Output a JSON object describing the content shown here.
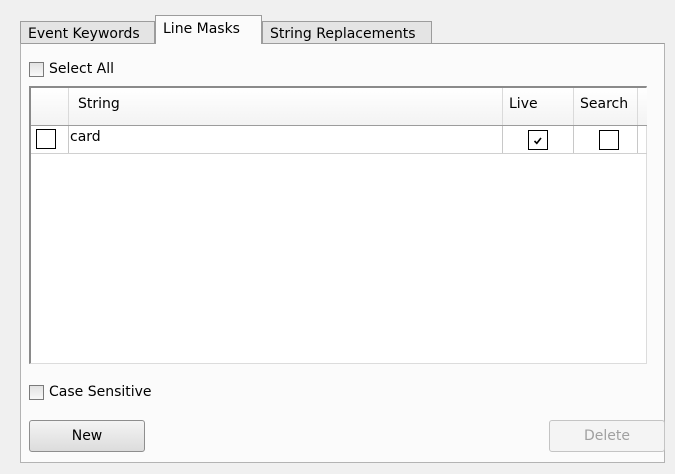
{
  "tabs": [
    {
      "label": "Event Keywords",
      "active": false
    },
    {
      "label": "Line Masks",
      "active": true
    },
    {
      "label": "String Replacements",
      "active": false
    }
  ],
  "select_all": {
    "label": "Select All",
    "checked": false
  },
  "grid": {
    "columns": [
      {
        "label": ""
      },
      {
        "label": "String"
      },
      {
        "label": "Live"
      },
      {
        "label": "Search"
      },
      {
        "label": ""
      }
    ],
    "rows": [
      {
        "selected": false,
        "string": "card",
        "live": true,
        "search": false
      }
    ]
  },
  "case_sensitive": {
    "label": "Case Sensitive",
    "checked": false
  },
  "buttons": {
    "new_label": "New",
    "delete_label": "Delete",
    "delete_enabled": false
  },
  "icons": {
    "check_mark": "check-mark-icon"
  }
}
